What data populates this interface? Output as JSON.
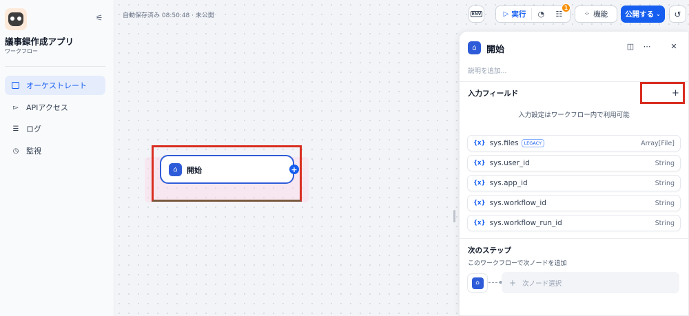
{
  "sidebar": {
    "app_name": "議事録作成アプリ",
    "app_type": "ワークフロー",
    "items": [
      {
        "label": "オーケストレート",
        "icon": "layout-icon",
        "active": true
      },
      {
        "label": "APIアクセス",
        "icon": "terminal-icon",
        "active": false
      },
      {
        "label": "ログ",
        "icon": "log-icon",
        "active": false
      },
      {
        "label": "監視",
        "icon": "monitor-icon",
        "active": false
      }
    ]
  },
  "canvas": {
    "autosave": "自動保存済み 08:50:48 · 未公開",
    "node": {
      "title": "開始"
    }
  },
  "toolbar": {
    "env": "ENV",
    "run": "実行",
    "badge": "1",
    "features": "機能",
    "publish": "公開する"
  },
  "panel": {
    "title": "開始",
    "description_placeholder": "説明を追加...",
    "input_fields_title": "入力フィールド",
    "input_hint": "入力設定はワークフロー内で利用可能",
    "variables": [
      {
        "name": "sys.files",
        "tag": "LEGACY",
        "type": "Array[File]"
      },
      {
        "name": "sys.user_id",
        "tag": "",
        "type": "String"
      },
      {
        "name": "sys.app_id",
        "tag": "",
        "type": "String"
      },
      {
        "name": "sys.workflow_id",
        "tag": "",
        "type": "String"
      },
      {
        "name": "sys.workflow_run_id",
        "tag": "",
        "type": "String"
      }
    ],
    "next_step_title": "次のステップ",
    "next_step_desc": "このワークフローで次ノードを追加",
    "next_node_select": "次ノード選択"
  },
  "colors": {
    "accent": "#155eef",
    "highlight": "#d92d20",
    "node_icon": "#2e5bd8"
  }
}
